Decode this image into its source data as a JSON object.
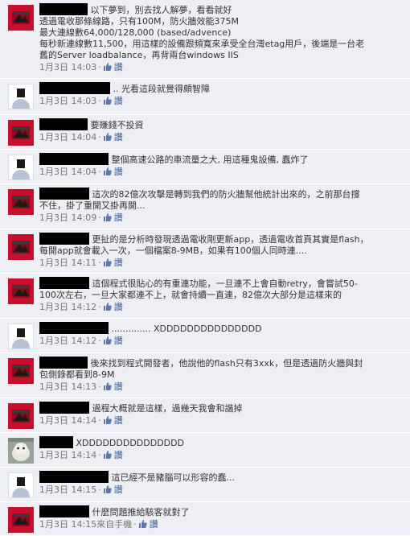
{
  "comments": [
    {
      "avatar": "red-avatar",
      "redact_width": 60,
      "lines": [
        "以下夢到，別去找人解夢，看看就好",
        "透過電收那條線路，只有100M，防火牆效能375M",
        "最大連線數64,000/128,000 (based/advence)",
        "每秒新連線數11,500，用這樣的設備跟頻寬來承受全台灣etag用戶，後端是一台老",
        "舊的Server loadbalance，再背兩台windows IIS"
      ],
      "date": "1月3日 14:03",
      "like_label": "讚"
    },
    {
      "avatar": "default-avatar",
      "redact_width": 88,
      "lines": [
        ".. 光看這段就覺得頗智障"
      ],
      "date": "1月3日 14:03",
      "like_label": "讚"
    },
    {
      "avatar": "red-avatar",
      "redact_width": 60,
      "lines": [
        "要賺錢不投資"
      ],
      "date": "1月3日 14:04",
      "like_label": "讚"
    },
    {
      "avatar": "default-avatar",
      "redact_width": 86,
      "lines": [
        "整個高速公路的車流量之大, 用這種鬼設備, 蠢炸了"
      ],
      "date": "1月3日 14:04",
      "like_label": "讚"
    },
    {
      "avatar": "red-avatar",
      "redact_width": 62,
      "lines": [
        "這次的82億次攻擊是轉到我們的防火牆幫他統計出來的，之前那台撐",
        "不住，掛了重開又掛再開..."
      ],
      "date": "1月3日 14:09",
      "like_label": "讚"
    },
    {
      "avatar": "red-avatar",
      "redact_width": 62,
      "lines": [
        "更扯的是分析時發現透過電收剛更新app，透過電收首頁其實是flash，",
        "每開app就會載入一次，一個檔案8-9MB，如果有100個人同時連...."
      ],
      "date": "1月3日 14:11",
      "like_label": "讚"
    },
    {
      "avatar": "red-avatar",
      "redact_width": 62,
      "lines": [
        "這個程式很貼心的有重連功能，一旦連不上會自動retry，會嘗試50-",
        "100次左右，一旦大家都連不上，就會持續一直連，82億次大部分是這樣來的"
      ],
      "date": "1月3日 14:12",
      "like_label": "讚"
    },
    {
      "avatar": "default-avatar",
      "redact_width": 86,
      "lines": [
        ".............. XDDDDDDDDDDDDDDD"
      ],
      "date": "1月3日 14:12",
      "like_label": "讚"
    },
    {
      "avatar": "red-avatar",
      "redact_width": 60,
      "lines": [
        "後來找到程式開發者，他說他的flash只有3xxk，但是透過防火牆與封",
        "包側錄都看到8-9M"
      ],
      "date": "1月3日 14:13",
      "like_label": "讚"
    },
    {
      "avatar": "red-avatar",
      "redact_width": 62,
      "lines": [
        "過程大概就是這樣，過幾天我會和諧掉"
      ],
      "date": "1月3日 14:14",
      "like_label": "讚"
    },
    {
      "avatar": "photo-avatar",
      "redact_width": 42,
      "lines": [
        "XDDDDDDDDDDDDDDD"
      ],
      "date": "1月3日 14:14",
      "like_label": "讚"
    },
    {
      "avatar": "default-avatar",
      "redact_width": 86,
      "lines": [
        "這已經不是豬腦可以形容的蠢..."
      ],
      "date": "1月3日 14:15",
      "like_label": "讚"
    },
    {
      "avatar": "red-avatar",
      "redact_width": 62,
      "lines": [
        "什麼問題推給駭客就對了"
      ],
      "date": "1月3日 14:15",
      "source": "來自手機",
      "like_label": "讚"
    }
  ],
  "colors": {
    "comment_bg": "#edeff4",
    "link": "#3b5998",
    "meta": "#777777",
    "text": "#333333"
  }
}
